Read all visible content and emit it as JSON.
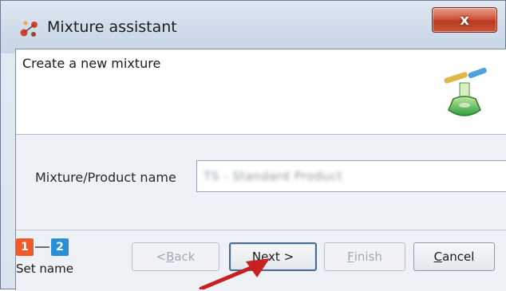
{
  "window": {
    "title": "Mixture assistant",
    "close_glyph": "x",
    "icons": {
      "app": "molecule-app-icon",
      "close": "close-icon"
    }
  },
  "header": {
    "title": "Create a new mixture",
    "icon": "flask-test-tubes-icon"
  },
  "form": {
    "name_label": "Mixture/Product name",
    "name_value": "TS - Standard Product"
  },
  "wizard": {
    "steps": [
      "1",
      "2"
    ],
    "current_step": 1,
    "current_step_name": "Set name",
    "colors": {
      "active": "#f05a28",
      "inactive": "#2b8fd6"
    }
  },
  "buttons": {
    "back": {
      "mnemonic": "B",
      "before": "< ",
      "after": "ack",
      "enabled": false
    },
    "next": {
      "mnemonic": "N",
      "before": "",
      "after": "ext >",
      "enabled": true
    },
    "finish": {
      "mnemonic": "F",
      "before": "",
      "after": "inish",
      "enabled": false
    },
    "cancel": {
      "mnemonic": "C",
      "before": "",
      "after": "ancel",
      "enabled": true
    }
  },
  "annotation": {
    "icon": "red-arrow-pointer-icon",
    "color": "#c8201e"
  }
}
